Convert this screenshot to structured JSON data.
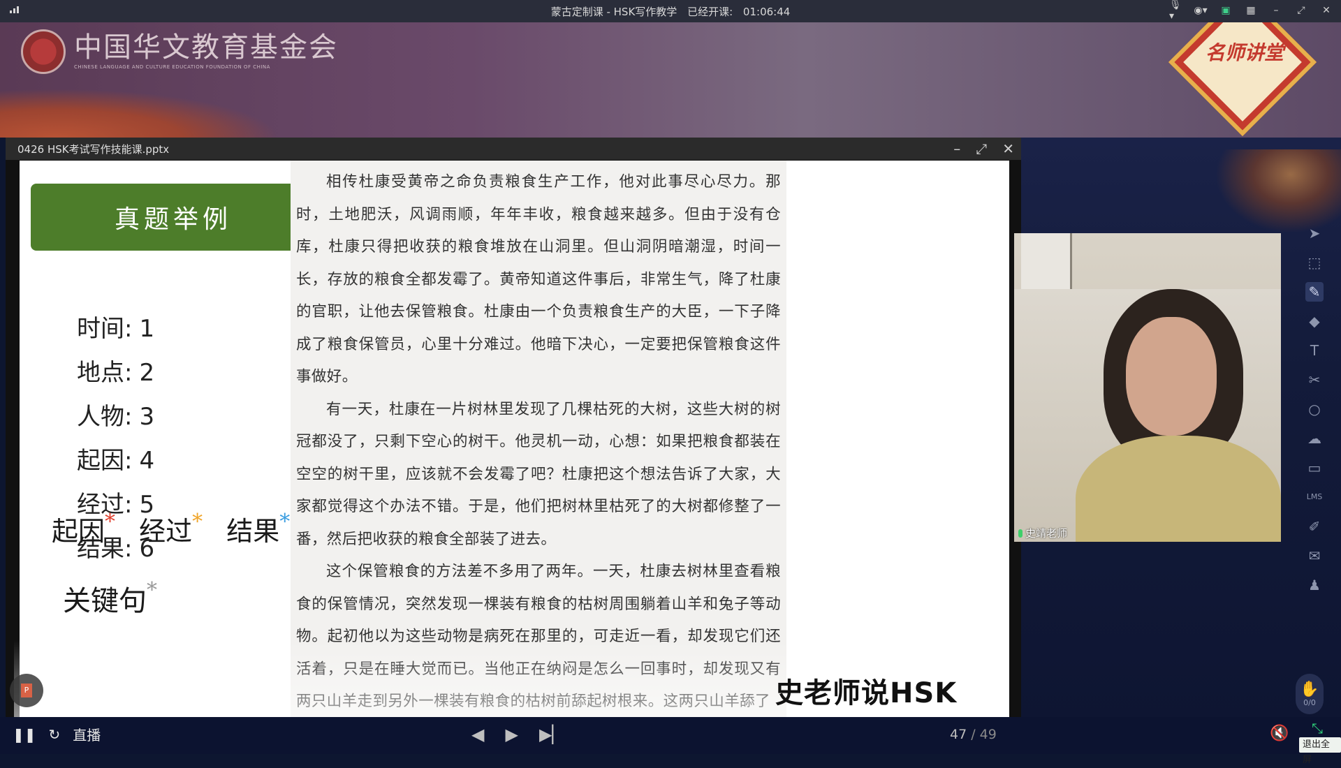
{
  "topbar": {
    "title": "蒙古定制课 - HSK写作教学",
    "elapsed_label": "已经开课:",
    "elapsed_time": "01:06:44"
  },
  "banner": {
    "logo_cn": "中国华文教育基金会",
    "logo_en": "CHINESE LANGUAGE AND CULTURE EDUCATION FOUNDATION OF CHINA",
    "badge_text": "名师讲堂"
  },
  "slide_window": {
    "filename": "0426 HSK考试写作技能课.pptx"
  },
  "slide": {
    "header": "真题举例",
    "items": [
      {
        "label": "时间:",
        "num": "1"
      },
      {
        "label": "地点:",
        "num": "2"
      },
      {
        "label": "人物:",
        "num": "3"
      },
      {
        "label": "起因:",
        "num": "4"
      },
      {
        "label": "经过:",
        "num": "5"
      },
      {
        "label": "结果:",
        "num": "6"
      }
    ],
    "key_points": [
      {
        "text": "起因",
        "color": "#e0402e"
      },
      {
        "text": "经过",
        "color": "#f0a52a"
      },
      {
        "text": "结果",
        "color": "#3a9de0"
      }
    ],
    "key_sentence": "关键句",
    "passage": [
      "相传杜康受黄帝之命负责粮食生产工作，他对此事尽心尽力。那时，土地肥沃，风调雨顺，年年丰收，粮食越来越多。但由于没有仓库，杜康只得把收获的粮食堆放在山洞里。但山洞阴暗潮湿，时间一长，存放的粮食全都发霉了。黄帝知道这件事后，非常生气，降了杜康的官职，让他去保管粮食。杜康由一个负责粮食生产的大臣，一下子降成了粮食保管员，心里十分难过。他暗下决心，一定要把保管粮食这件事做好。",
      "有一天，杜康在一片树林里发现了几棵枯死的大树，这些大树的树冠都没了，只剩下空心的树干。他灵机一动，心想：如果把粮食都装在空空的树干里，应该就不会发霉了吧？杜康把这个想法告诉了大家，大家都觉得这个办法不错。于是，他们把树林里枯死了的大树都修整了一番，然后把收获的粮食全部装了进去。",
      "这个保管粮食的方法差不多用了两年。一天，杜康去树林里查看粮食的保管情况，突然发现一棵装有粮食的枯树周围躺着山羊和兔子等动物。起初他以为这些动物是病死在那里的，可走近一看，却发现它们还活着，只是在睡大觉而已。当他正在纳闷是怎么一回事时，却发现又有两只山羊走到另外一棵装有粮食的枯树前舔起树根来。这两只山羊舔了"
    ],
    "watermark": "史老师说HSK"
  },
  "video": {
    "name": "史靖老师"
  },
  "bottombar": {
    "live_label": "直播",
    "current_page": "47",
    "total_pages": "/ 49",
    "exit_fullscreen": "退出全屏"
  },
  "hand_count": "0/0"
}
